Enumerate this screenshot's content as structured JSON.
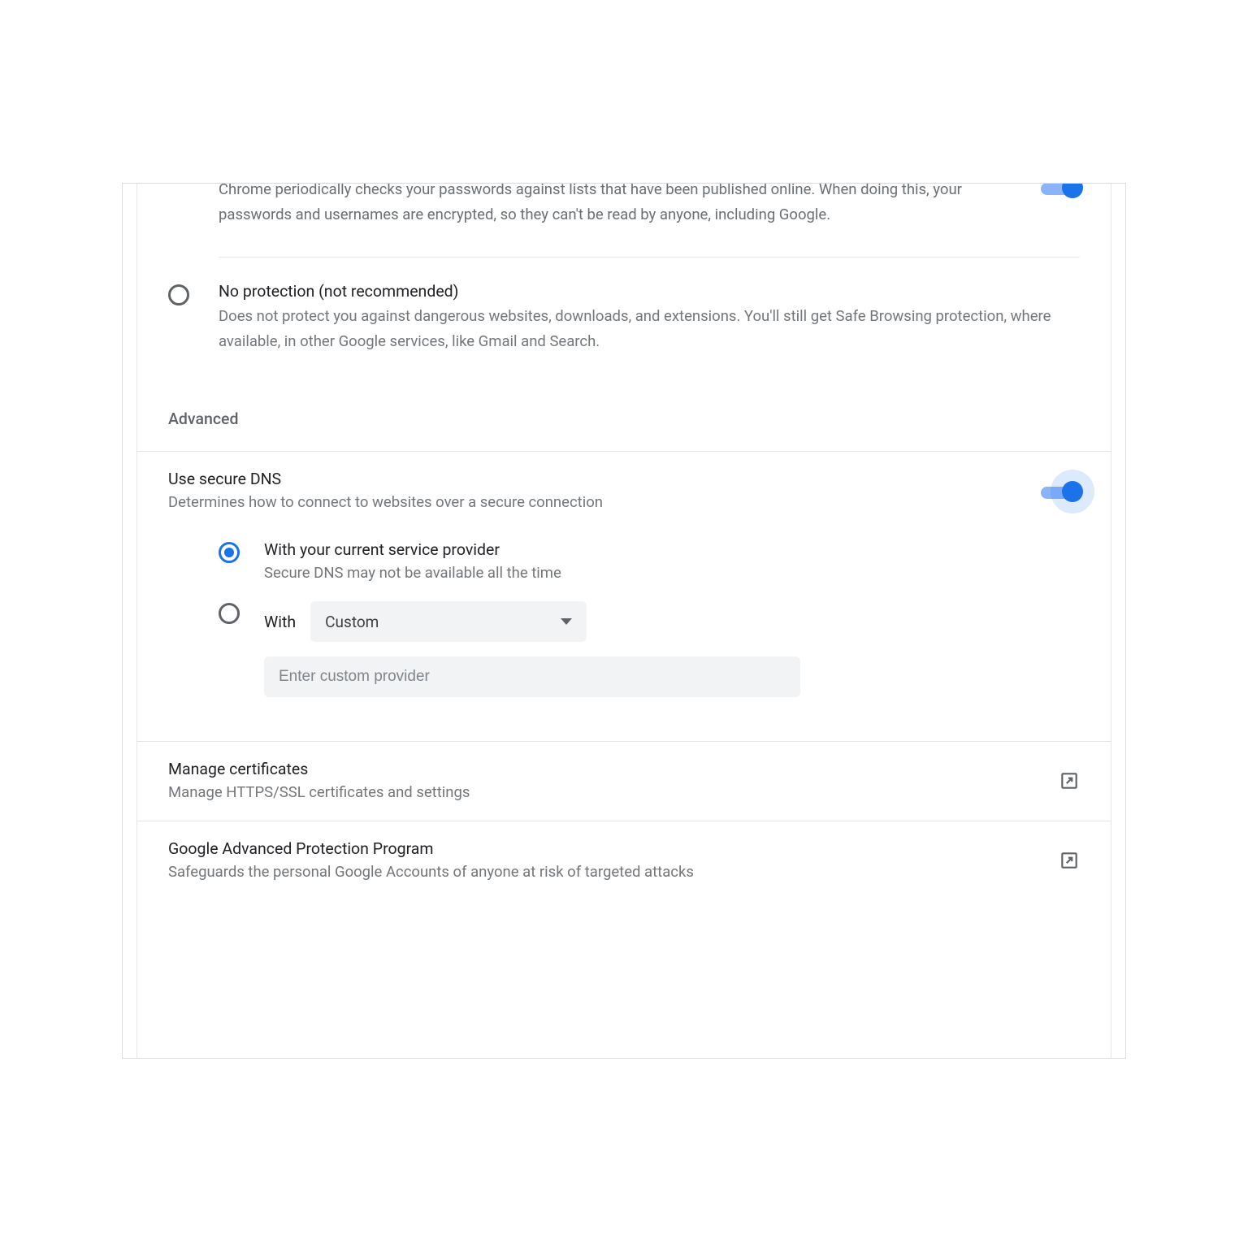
{
  "password_check": {
    "description": "Chrome periodically checks your passwords against lists that have been published online. When doing this, your passwords and usernames are encrypted, so they can't be read by anyone, including Google.",
    "enabled": true
  },
  "no_protection": {
    "title": "No protection (not recommended)",
    "description": "Does not protect you against dangerous websites, downloads, and extensions. You'll still get Safe Browsing protection, where available, in other Google services, like Gmail and Search.",
    "selected": false
  },
  "section_advanced": "Advanced",
  "secure_dns": {
    "title": "Use secure DNS",
    "description": "Determines how to connect to websites over a secure connection",
    "enabled": true,
    "options": {
      "current": {
        "label": "With your current service provider",
        "sublabel": "Secure DNS may not be available all the time",
        "selected": true
      },
      "custom": {
        "label": "With",
        "selected": false,
        "dropdown_value": "Custom",
        "input_placeholder": "Enter custom provider",
        "input_value": ""
      }
    }
  },
  "certificates": {
    "title": "Manage certificates",
    "description": "Manage HTTPS/SSL certificates and settings"
  },
  "advanced_protection": {
    "title": "Google Advanced Protection Program",
    "description": "Safeguards the personal Google Accounts of anyone at risk of targeted attacks"
  }
}
